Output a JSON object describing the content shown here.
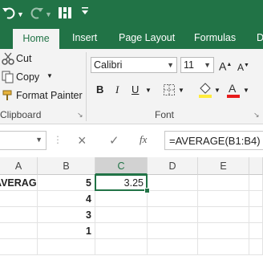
{
  "toolbar": {
    "undo_icon": "undo-icon",
    "redo_icon": "redo-icon",
    "customize_icon": "customize-icon"
  },
  "tabs": [
    {
      "label": "Home",
      "active": true
    },
    {
      "label": "Insert"
    },
    {
      "label": "Page Layout"
    },
    {
      "label": "Formulas"
    },
    {
      "label": "D"
    }
  ],
  "clipboard": {
    "cut": "Cut",
    "copy": "Copy",
    "format_painter": "Format Painter",
    "group_label": "Clipboard"
  },
  "font": {
    "name": "Calibri",
    "size": "11",
    "group_label": "Font",
    "bold": "B",
    "italic": "I",
    "underline": "U"
  },
  "formula_bar": {
    "name_box": "",
    "cancel": "×",
    "enter": "✓",
    "fx": "fx",
    "formula": "=AVERAGE(B1:B4)"
  },
  "columns": [
    "A",
    "B",
    "C",
    "D",
    "E"
  ],
  "cells": {
    "a1": "AVERAGE",
    "b": [
      "5",
      "4",
      "3",
      "1"
    ],
    "c1": "3.25"
  },
  "colors": {
    "brand": "#217346"
  }
}
